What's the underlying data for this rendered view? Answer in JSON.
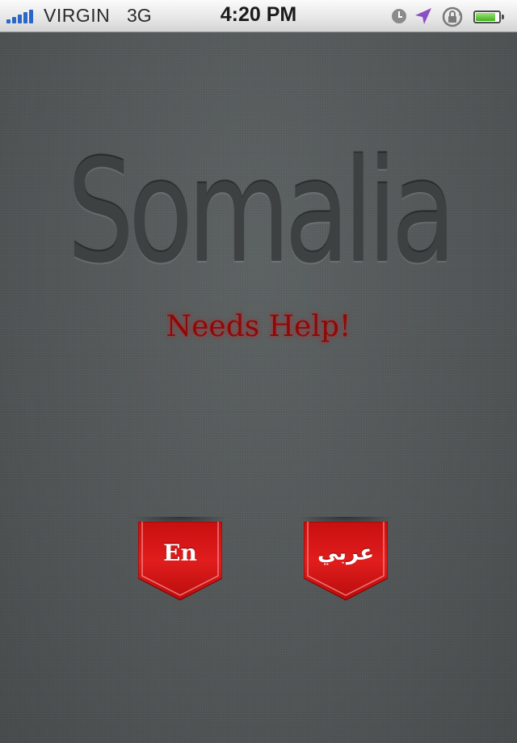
{
  "status_bar": {
    "carrier": "VIRGIN",
    "network": "3G",
    "time": "4:20 PM",
    "signal_bars": 5,
    "battery_level": 0.85,
    "icons": [
      "signal-icon",
      "clock-icon",
      "location-icon",
      "rotation-lock-icon",
      "battery-icon"
    ],
    "colors": {
      "signal": "#2a67c9",
      "location": "#8a4fc4",
      "battery": "#3fb21c"
    }
  },
  "main": {
    "title": "Somalia",
    "subtitle": "Needs Help!",
    "colors": {
      "subtitle": "#8a0a0a",
      "ribbon": "#d41414",
      "background": "#535758"
    }
  },
  "language_buttons": {
    "english": "En",
    "arabic": "عربي"
  }
}
